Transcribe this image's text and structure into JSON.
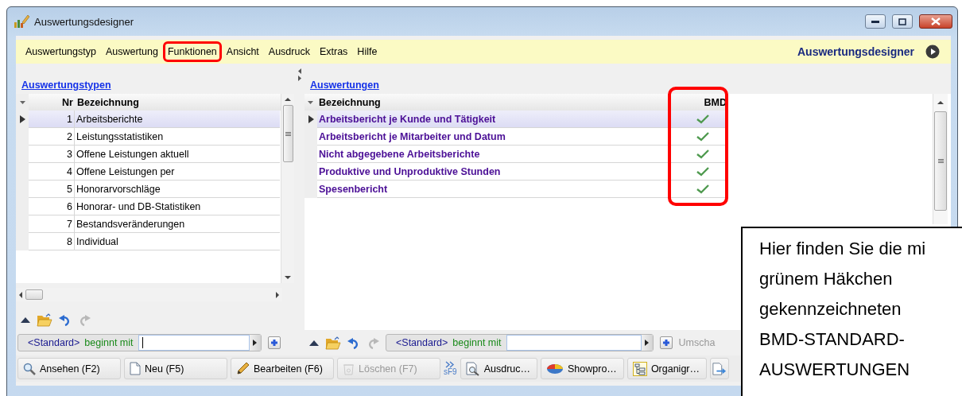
{
  "window": {
    "title": "Auswertungsdesigner"
  },
  "menu": [
    {
      "label": "Auswertungstyp",
      "highlighted": false
    },
    {
      "label": "Auswertung",
      "highlighted": false
    },
    {
      "label": "Funktionen",
      "highlighted": true
    },
    {
      "label": "Ansicht",
      "highlighted": false
    },
    {
      "label": "Ausdruck",
      "highlighted": false
    },
    {
      "label": "Extras",
      "highlighted": false
    },
    {
      "label": "Hilfe",
      "highlighted": false
    }
  ],
  "menu_title": "Auswertungsdesigner",
  "auswertungstypen": {
    "title": "Auswertungstypen",
    "columns": [
      {
        "label": "Nr"
      },
      {
        "label": "Bezeichnung"
      }
    ],
    "rows": [
      {
        "nr": "1",
        "name": "Arbeitsberichte",
        "selected": true
      },
      {
        "nr": "2",
        "name": "Leistungsstatistiken",
        "selected": false
      },
      {
        "nr": "3",
        "name": "Offene Leistungen aktuell",
        "selected": false
      },
      {
        "nr": "4",
        "name": "Offene Leistungen per",
        "selected": false
      },
      {
        "nr": "5",
        "name": "Honorarvorschläge",
        "selected": false
      },
      {
        "nr": "6",
        "name": "Honorar- und DB-Statistiken",
        "selected": false
      },
      {
        "nr": "7",
        "name": "Bestandsveränderungen",
        "selected": false
      },
      {
        "nr": "8",
        "name": "Individual",
        "selected": false
      }
    ],
    "filter": {
      "scope": "<Standard>",
      "operator": "beginnt mit",
      "focused": true
    }
  },
  "auswertungen": {
    "title": "Auswertungen",
    "columns": [
      {
        "label": "Bezeichnung",
        "highlighted": false
      },
      {
        "label": "BMD",
        "highlighted": true
      }
    ],
    "rows": [
      {
        "name": "Arbeitsbericht je Kunde und Tätigkeit",
        "bmd": true,
        "selected": true
      },
      {
        "name": "Arbeitsbericht je Mitarbeiter und Datum",
        "bmd": true,
        "selected": false
      },
      {
        "name": "Nicht abgegebene Arbeitsberichte",
        "bmd": true,
        "selected": false
      },
      {
        "name": "Produktive und Unproduktive Stunden",
        "bmd": true,
        "selected": false
      },
      {
        "name": "Spesenbericht",
        "bmd": true,
        "selected": false
      }
    ],
    "filter": {
      "scope": "<Standard>",
      "operator": "beginnt mit",
      "focused": false
    },
    "hint": "Umscha"
  },
  "buttons": [
    {
      "label": "Ansehen (F2)",
      "kind": "view",
      "disabled": false
    },
    {
      "label": "Neu (F5)",
      "kind": "new",
      "disabled": false
    },
    {
      "label": "Bearbeiten (F6)",
      "kind": "edit",
      "disabled": false
    },
    {
      "label": "Löschen (F7)",
      "kind": "delete",
      "disabled": true
    },
    {
      "label": "sF9",
      "kind": "more",
      "disabled": false
    },
    {
      "label": "Ausdruc…",
      "kind": "print",
      "disabled": false
    },
    {
      "label": "Showpro…",
      "kind": "presentation",
      "disabled": false
    },
    {
      "label": "Organigr…",
      "kind": "orgchart",
      "disabled": false
    },
    {
      "kind": "export",
      "disabled": false
    }
  ],
  "callout": {
    "text": "Hier finden Sie die mi\ngrünem Häkchen\ngekennzeichneten\nBMD-STANDARD-\nAUSWERTUNGEN"
  }
}
